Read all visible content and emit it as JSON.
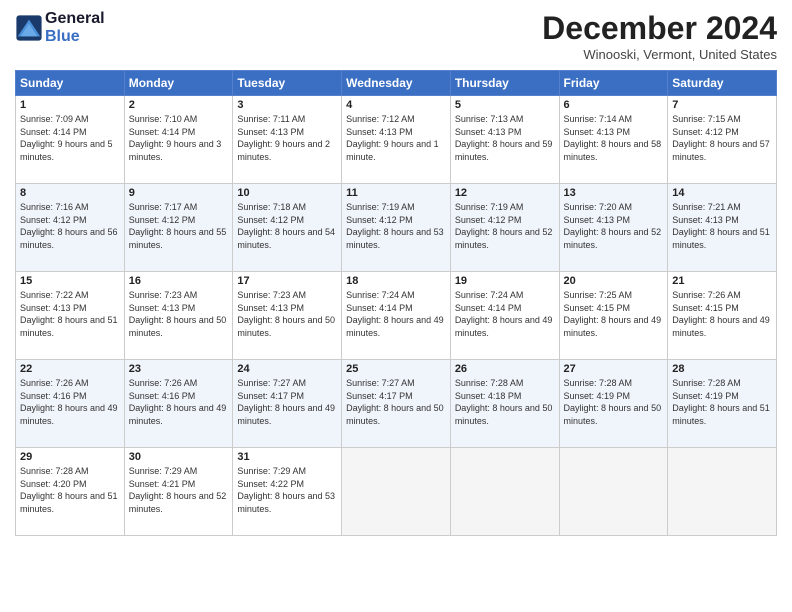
{
  "header": {
    "logo_general": "General",
    "logo_blue": "Blue",
    "title": "December 2024",
    "location": "Winooski, Vermont, United States"
  },
  "days_of_week": [
    "Sunday",
    "Monday",
    "Tuesday",
    "Wednesday",
    "Thursday",
    "Friday",
    "Saturday"
  ],
  "weeks": [
    [
      {
        "day": "1",
        "sunrise": "Sunrise: 7:09 AM",
        "sunset": "Sunset: 4:14 PM",
        "daylight": "Daylight: 9 hours and 5 minutes."
      },
      {
        "day": "2",
        "sunrise": "Sunrise: 7:10 AM",
        "sunset": "Sunset: 4:14 PM",
        "daylight": "Daylight: 9 hours and 3 minutes."
      },
      {
        "day": "3",
        "sunrise": "Sunrise: 7:11 AM",
        "sunset": "Sunset: 4:13 PM",
        "daylight": "Daylight: 9 hours and 2 minutes."
      },
      {
        "day": "4",
        "sunrise": "Sunrise: 7:12 AM",
        "sunset": "Sunset: 4:13 PM",
        "daylight": "Daylight: 9 hours and 1 minute."
      },
      {
        "day": "5",
        "sunrise": "Sunrise: 7:13 AM",
        "sunset": "Sunset: 4:13 PM",
        "daylight": "Daylight: 8 hours and 59 minutes."
      },
      {
        "day": "6",
        "sunrise": "Sunrise: 7:14 AM",
        "sunset": "Sunset: 4:13 PM",
        "daylight": "Daylight: 8 hours and 58 minutes."
      },
      {
        "day": "7",
        "sunrise": "Sunrise: 7:15 AM",
        "sunset": "Sunset: 4:12 PM",
        "daylight": "Daylight: 8 hours and 57 minutes."
      }
    ],
    [
      {
        "day": "8",
        "sunrise": "Sunrise: 7:16 AM",
        "sunset": "Sunset: 4:12 PM",
        "daylight": "Daylight: 8 hours and 56 minutes."
      },
      {
        "day": "9",
        "sunrise": "Sunrise: 7:17 AM",
        "sunset": "Sunset: 4:12 PM",
        "daylight": "Daylight: 8 hours and 55 minutes."
      },
      {
        "day": "10",
        "sunrise": "Sunrise: 7:18 AM",
        "sunset": "Sunset: 4:12 PM",
        "daylight": "Daylight: 8 hours and 54 minutes."
      },
      {
        "day": "11",
        "sunrise": "Sunrise: 7:19 AM",
        "sunset": "Sunset: 4:12 PM",
        "daylight": "Daylight: 8 hours and 53 minutes."
      },
      {
        "day": "12",
        "sunrise": "Sunrise: 7:19 AM",
        "sunset": "Sunset: 4:12 PM",
        "daylight": "Daylight: 8 hours and 52 minutes."
      },
      {
        "day": "13",
        "sunrise": "Sunrise: 7:20 AM",
        "sunset": "Sunset: 4:13 PM",
        "daylight": "Daylight: 8 hours and 52 minutes."
      },
      {
        "day": "14",
        "sunrise": "Sunrise: 7:21 AM",
        "sunset": "Sunset: 4:13 PM",
        "daylight": "Daylight: 8 hours and 51 minutes."
      }
    ],
    [
      {
        "day": "15",
        "sunrise": "Sunrise: 7:22 AM",
        "sunset": "Sunset: 4:13 PM",
        "daylight": "Daylight: 8 hours and 51 minutes."
      },
      {
        "day": "16",
        "sunrise": "Sunrise: 7:23 AM",
        "sunset": "Sunset: 4:13 PM",
        "daylight": "Daylight: 8 hours and 50 minutes."
      },
      {
        "day": "17",
        "sunrise": "Sunrise: 7:23 AM",
        "sunset": "Sunset: 4:13 PM",
        "daylight": "Daylight: 8 hours and 50 minutes."
      },
      {
        "day": "18",
        "sunrise": "Sunrise: 7:24 AM",
        "sunset": "Sunset: 4:14 PM",
        "daylight": "Daylight: 8 hours and 49 minutes."
      },
      {
        "day": "19",
        "sunrise": "Sunrise: 7:24 AM",
        "sunset": "Sunset: 4:14 PM",
        "daylight": "Daylight: 8 hours and 49 minutes."
      },
      {
        "day": "20",
        "sunrise": "Sunrise: 7:25 AM",
        "sunset": "Sunset: 4:15 PM",
        "daylight": "Daylight: 8 hours and 49 minutes."
      },
      {
        "day": "21",
        "sunrise": "Sunrise: 7:26 AM",
        "sunset": "Sunset: 4:15 PM",
        "daylight": "Daylight: 8 hours and 49 minutes."
      }
    ],
    [
      {
        "day": "22",
        "sunrise": "Sunrise: 7:26 AM",
        "sunset": "Sunset: 4:16 PM",
        "daylight": "Daylight: 8 hours and 49 minutes."
      },
      {
        "day": "23",
        "sunrise": "Sunrise: 7:26 AM",
        "sunset": "Sunset: 4:16 PM",
        "daylight": "Daylight: 8 hours and 49 minutes."
      },
      {
        "day": "24",
        "sunrise": "Sunrise: 7:27 AM",
        "sunset": "Sunset: 4:17 PM",
        "daylight": "Daylight: 8 hours and 49 minutes."
      },
      {
        "day": "25",
        "sunrise": "Sunrise: 7:27 AM",
        "sunset": "Sunset: 4:17 PM",
        "daylight": "Daylight: 8 hours and 50 minutes."
      },
      {
        "day": "26",
        "sunrise": "Sunrise: 7:28 AM",
        "sunset": "Sunset: 4:18 PM",
        "daylight": "Daylight: 8 hours and 50 minutes."
      },
      {
        "day": "27",
        "sunrise": "Sunrise: 7:28 AM",
        "sunset": "Sunset: 4:19 PM",
        "daylight": "Daylight: 8 hours and 50 minutes."
      },
      {
        "day": "28",
        "sunrise": "Sunrise: 7:28 AM",
        "sunset": "Sunset: 4:19 PM",
        "daylight": "Daylight: 8 hours and 51 minutes."
      }
    ],
    [
      {
        "day": "29",
        "sunrise": "Sunrise: 7:28 AM",
        "sunset": "Sunset: 4:20 PM",
        "daylight": "Daylight: 8 hours and 51 minutes."
      },
      {
        "day": "30",
        "sunrise": "Sunrise: 7:29 AM",
        "sunset": "Sunset: 4:21 PM",
        "daylight": "Daylight: 8 hours and 52 minutes."
      },
      {
        "day": "31",
        "sunrise": "Sunrise: 7:29 AM",
        "sunset": "Sunset: 4:22 PM",
        "daylight": "Daylight: 8 hours and 53 minutes."
      },
      null,
      null,
      null,
      null
    ]
  ]
}
